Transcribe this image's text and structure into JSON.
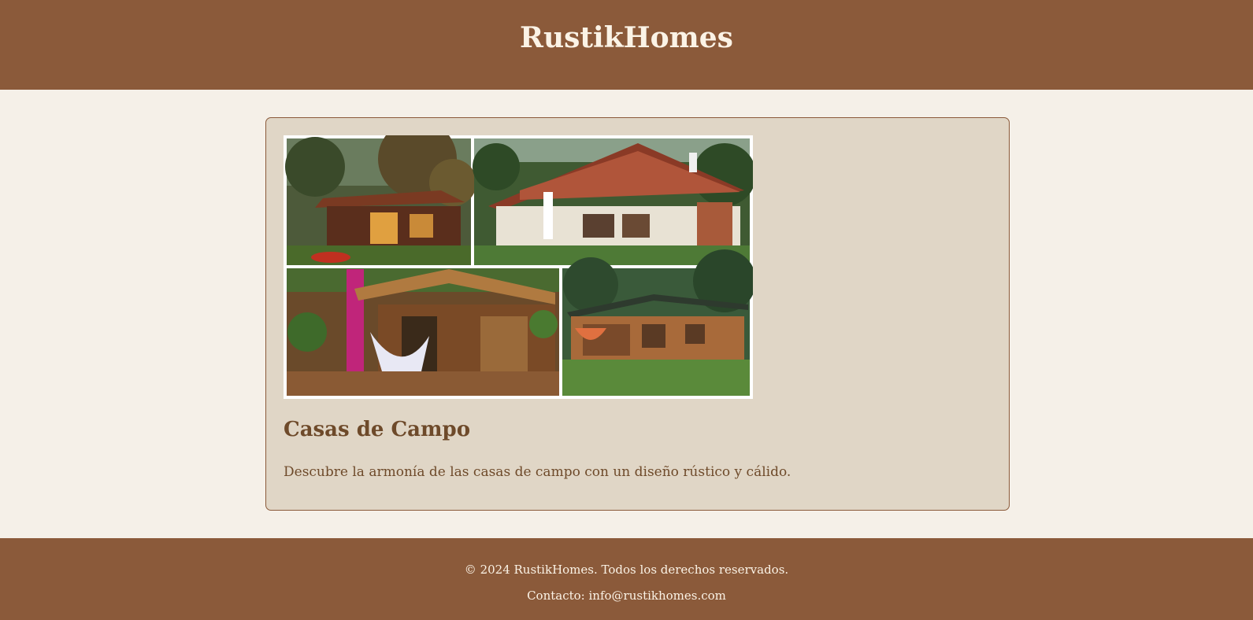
{
  "header": {
    "title": "RustikHomes"
  },
  "card": {
    "image": {
      "description_icon": "country-houses-collage-image"
    },
    "title": "Casas de Campo",
    "description": "Descubre la armonía de las casas de campo con un diseño rústico y cálido."
  },
  "footer": {
    "copyright": "© 2024 RustikHomes. Todos los derechos reservados.",
    "contact": "Contacto: info@rustikhomes.com"
  },
  "colors": {
    "brand": "#8b5a3a",
    "background": "#f5f0e8",
    "card_background": "#e0d6c6",
    "heading": "#6e4a2a",
    "header_text": "#fbf3e6"
  }
}
